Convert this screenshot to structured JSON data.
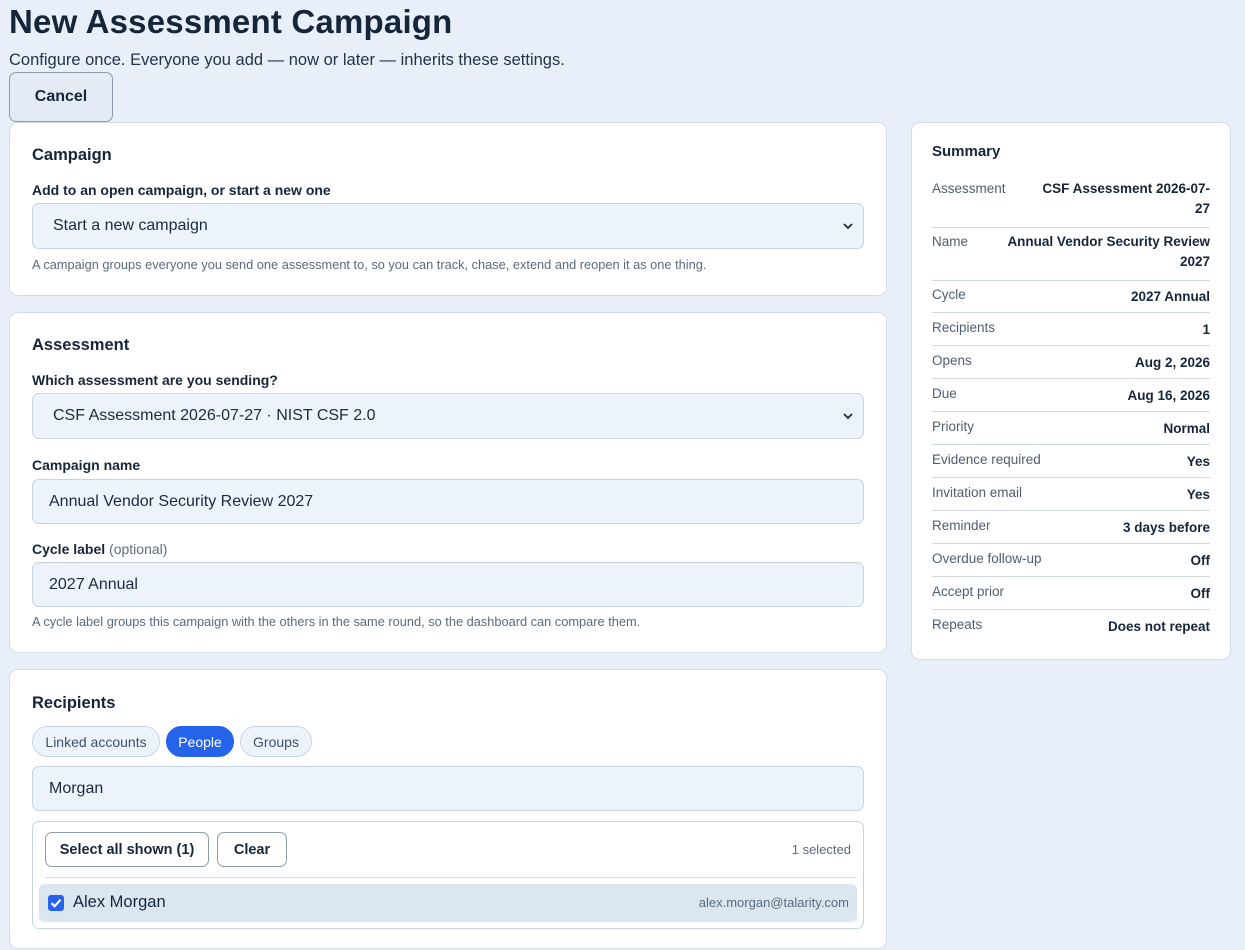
{
  "header": {
    "title": "New Assessment Campaign",
    "subtitle": "Configure once. Everyone you add — now or later — inherits these settings.",
    "cancel_label": "Cancel"
  },
  "campaign": {
    "title": "Campaign",
    "label": "Add to an open campaign, or start a new one",
    "selected": "Start a new campaign",
    "help": "A campaign groups everyone you send one assessment to, so you can track, chase, extend and reopen it as one thing."
  },
  "assessment": {
    "title": "Assessment",
    "assessment_label": "Which assessment are you sending?",
    "assessment_selected": "CSF Assessment 2026-07-27 · NIST CSF 2.0",
    "name_label": "Campaign name",
    "name_value": "Annual Vendor Security Review 2027",
    "cycle_label": "Cycle label",
    "cycle_optional": "(optional)",
    "cycle_value": "2027 Annual",
    "cycle_help": "A cycle label groups this campaign with the others in the same round, so the dashboard can compare them."
  },
  "recipients": {
    "title": "Recipients",
    "tabs": [
      {
        "label": "Linked accounts",
        "active": false
      },
      {
        "label": "People",
        "active": true
      },
      {
        "label": "Groups",
        "active": false
      }
    ],
    "search_value": "Morgan",
    "select_all_label": "Select all shown (1)",
    "clear_label": "Clear",
    "selected_count": "1 selected",
    "people": [
      {
        "name": "Alex Morgan",
        "email": "alex.morgan@talarity.com",
        "checked": true
      }
    ]
  },
  "summary": {
    "title": "Summary",
    "rows": [
      {
        "label": "Assessment",
        "value": "CSF Assessment 2026-07-27"
      },
      {
        "label": "Name",
        "value": "Annual Vendor Security Review 2027"
      },
      {
        "label": "Cycle",
        "value": "2027 Annual"
      },
      {
        "label": "Recipients",
        "value": "1"
      },
      {
        "label": "Opens",
        "value": "Aug 2, 2026"
      },
      {
        "label": "Due",
        "value": "Aug 16, 2026"
      },
      {
        "label": "Priority",
        "value": "Normal"
      },
      {
        "label": "Evidence required",
        "value": "Yes"
      },
      {
        "label": "Invitation email",
        "value": "Yes"
      },
      {
        "label": "Reminder",
        "value": "3 days before"
      },
      {
        "label": "Overdue follow-up",
        "value": "Off"
      },
      {
        "label": "Accept prior",
        "value": "Off"
      },
      {
        "label": "Repeats",
        "value": "Does not repeat"
      }
    ]
  },
  "colors": {
    "accent": "#2563eb",
    "background": "#e9eff8",
    "card": "#ffffff"
  }
}
